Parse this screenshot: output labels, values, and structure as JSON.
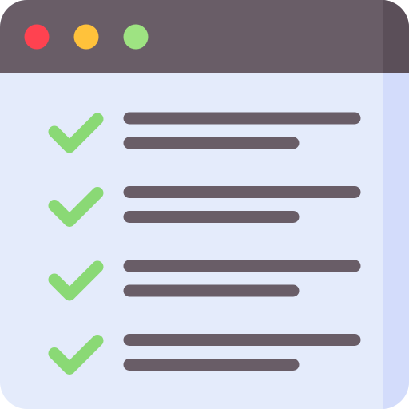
{
  "window": {
    "titlebar_color": "#695d67",
    "titlebar_shade_color": "#5b4f59",
    "body_color": "#e4ebfb",
    "body_shade_color": "#d3dcfb",
    "controls": [
      {
        "name": "close-dot",
        "color": "#ff4250"
      },
      {
        "name": "minimize-dot",
        "color": "#ffc23b"
      },
      {
        "name": "maximize-dot",
        "color": "#9ee382"
      }
    ]
  },
  "checklist": {
    "check_color": "#8ad975",
    "line_color": "#695d67",
    "items": [
      {
        "checked": true,
        "icon": "checkmark-icon"
      },
      {
        "checked": true,
        "icon": "checkmark-icon"
      },
      {
        "checked": true,
        "icon": "checkmark-icon"
      },
      {
        "checked": true,
        "icon": "checkmark-icon"
      }
    ]
  }
}
